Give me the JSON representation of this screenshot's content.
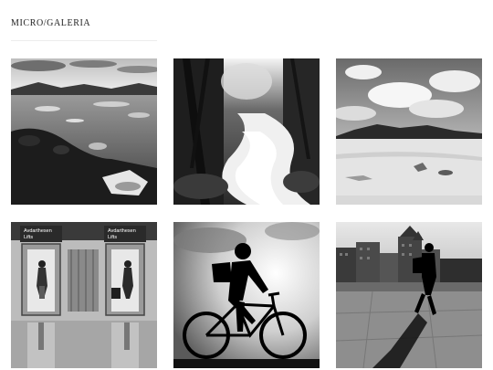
{
  "header": {
    "site_title": "MICRO/GALERIA"
  },
  "gallery": {
    "photos": [
      {
        "subject": "rocky lakeshore with mountains under cloudy sky"
      },
      {
        "subject": "long-exposure waterfall stream in dark forest"
      },
      {
        "subject": "snowy plain with distant hills and bright clouds"
      },
      {
        "subject": "people walking past elevators at station",
        "signs": [
          "Avdarthesen",
          "Lifts",
          "Avdarthesen",
          "Lifts"
        ]
      },
      {
        "subject": "silhouette of cyclist riding bicycle"
      },
      {
        "subject": "silhouette of pedestrian walking along waterfront"
      }
    ]
  },
  "colors": {
    "background": "#ffffff",
    "title_text": "#222222",
    "rule": "#ececec"
  }
}
